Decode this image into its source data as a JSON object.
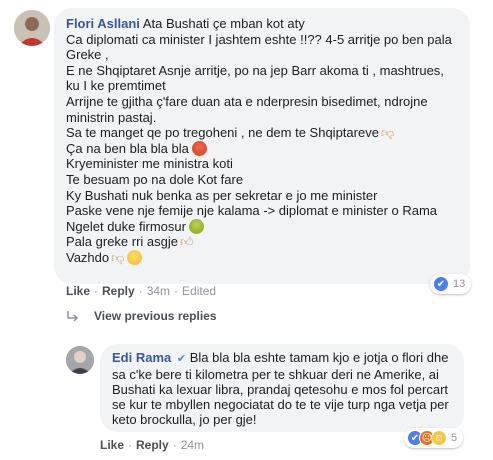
{
  "comment": {
    "author": "Flori Asllani",
    "lines": [
      "Ata Bushati çe mban kot aty",
      "Ca diplomati ca minister I jashtem eshte !!?? 4-5 arritje po ben pala",
      "Greke ,",
      "E ne Shqiptaret Asnje arritje, po na jep Barr akoma ti , mashtrues,",
      "ku I ke premtimet",
      "Arrijne te gjitha ç'fare duan ata e nderpresin bisedimet, ndrojne",
      "ministrin pastaj.",
      "Sa te manget qe po tregoheni , ne dem te Shqiptareve",
      "Ça na ben bla bla bla",
      "Kryeminister me ministra koti",
      "Te besuam po na dole Kot fare",
      "Ky Bushati nuk benka as per sekretar e jo me minister",
      "Paske vene nje femije nje kalama -> diplomat e minister o Rama",
      "Ngelet duke firmosur",
      "Pala greke rri asgje",
      "Vazhdo"
    ],
    "actions": {
      "like": "Like",
      "reply": "Reply",
      "time": "34m",
      "edited": "Edited"
    },
    "reactions": {
      "icons": [
        "like-icon"
      ],
      "count": "13"
    }
  },
  "view_previous": "View previous replies",
  "reply": {
    "author": "Edi Rama",
    "text": "Bla bla bla eshte tamam kjo e jotja o flori dhe sa c'ke bere ti kilometra per te shkuar deri ne Amerike, ai Bushati ka lexuar libra, prandaj qetesohu e mos fol percart se kur te mbyllen negociatat do te te vije turp nga vetja per keto brockulla, jo per gje!",
    "actions": {
      "like": "Like",
      "reply": "Reply",
      "time": "24m"
    },
    "reactions": {
      "icons": [
        "like-icon",
        "angry-icon",
        "haha-icon"
      ],
      "count": "5"
    }
  },
  "colors": {
    "author": "#385898",
    "bubble": "#f2f3f5",
    "meta": "#90949c",
    "like_blue": "#4a7ff2"
  }
}
